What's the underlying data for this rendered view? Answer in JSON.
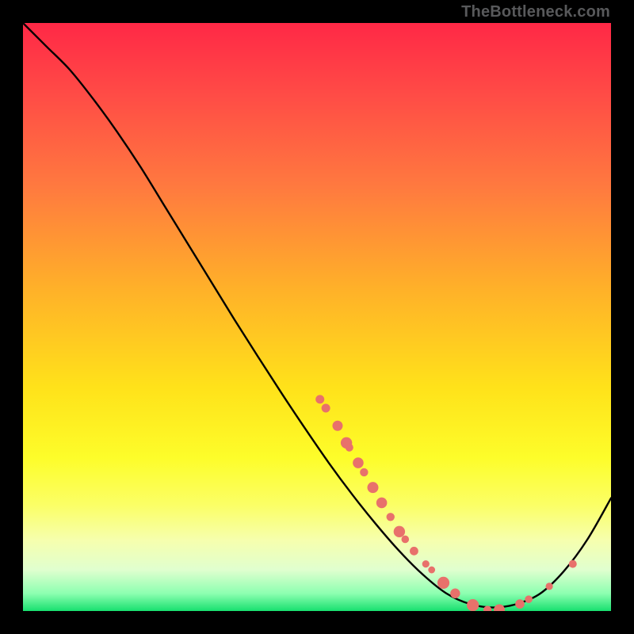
{
  "attribution": "TheBottleneck.com",
  "colors": {
    "curve": "#000000",
    "dots": "#e8716b",
    "gradient_stops": [
      {
        "offset": "0%",
        "color": "#ff2846"
      },
      {
        "offset": "12%",
        "color": "#ff4b46"
      },
      {
        "offset": "28%",
        "color": "#ff7a3f"
      },
      {
        "offset": "45%",
        "color": "#ffb029"
      },
      {
        "offset": "62%",
        "color": "#ffe21a"
      },
      {
        "offset": "74%",
        "color": "#fdfd2a"
      },
      {
        "offset": "82%",
        "color": "#fbff66"
      },
      {
        "offset": "88%",
        "color": "#f6ffae"
      },
      {
        "offset": "93%",
        "color": "#e0ffcf"
      },
      {
        "offset": "97%",
        "color": "#8dffb1"
      },
      {
        "offset": "100%",
        "color": "#18e06f"
      }
    ]
  },
  "geometry": {
    "plot_size": 742
  },
  "chart_data": {
    "type": "line",
    "title": "",
    "xlabel": "",
    "ylabel": "",
    "xlim": [
      0,
      100
    ],
    "ylim": [
      0,
      100
    ],
    "series": [
      {
        "name": "bottleneck-curve",
        "x": [
          0,
          4,
          8,
          12,
          16,
          20,
          24,
          28,
          32,
          36,
          40,
          44,
          48,
          52,
          56,
          60,
          64,
          68,
          72,
          76,
          80,
          84,
          88,
          92,
          96,
          100
        ],
        "y": [
          100,
          96,
          92,
          87,
          81.5,
          75.5,
          69,
          62.5,
          56,
          49.5,
          43.2,
          37,
          31,
          25.2,
          19.8,
          14.8,
          10.2,
          6.2,
          3.0,
          1.2,
          0.6,
          1.2,
          3.0,
          6.8,
          12.2,
          19.2
        ]
      }
    ],
    "scatter": {
      "name": "sample-points",
      "points": [
        {
          "x": 50.5,
          "y": 36.0,
          "r": 5.5
        },
        {
          "x": 51.5,
          "y": 34.5,
          "r": 5.5
        },
        {
          "x": 53.5,
          "y": 31.5,
          "r": 6.5
        },
        {
          "x": 55.0,
          "y": 28.6,
          "r": 7.2
        },
        {
          "x": 55.5,
          "y": 27.8,
          "r": 5.0
        },
        {
          "x": 57.0,
          "y": 25.2,
          "r": 6.8
        },
        {
          "x": 58.0,
          "y": 23.6,
          "r": 5.2
        },
        {
          "x": 59.5,
          "y": 21.0,
          "r": 7.0
        },
        {
          "x": 61.0,
          "y": 18.4,
          "r": 6.8
        },
        {
          "x": 62.5,
          "y": 16.0,
          "r": 5.2
        },
        {
          "x": 64.0,
          "y": 13.5,
          "r": 7.2
        },
        {
          "x": 65.0,
          "y": 12.2,
          "r": 4.8
        },
        {
          "x": 66.5,
          "y": 10.2,
          "r": 5.4
        },
        {
          "x": 68.5,
          "y": 8.0,
          "r": 4.6
        },
        {
          "x": 69.5,
          "y": 7.0,
          "r": 4.4
        },
        {
          "x": 71.5,
          "y": 4.8,
          "r": 7.6
        },
        {
          "x": 73.5,
          "y": 3.0,
          "r": 6.2
        },
        {
          "x": 76.5,
          "y": 1.0,
          "r": 7.6
        },
        {
          "x": 79.0,
          "y": 0.2,
          "r": 5.2
        },
        {
          "x": 81.0,
          "y": 0.2,
          "r": 7.0
        },
        {
          "x": 84.5,
          "y": 1.2,
          "r": 5.8
        },
        {
          "x": 86.0,
          "y": 2.0,
          "r": 4.8
        },
        {
          "x": 89.5,
          "y": 4.2,
          "r": 4.6
        },
        {
          "x": 93.5,
          "y": 8.0,
          "r": 5.0
        }
      ]
    }
  }
}
